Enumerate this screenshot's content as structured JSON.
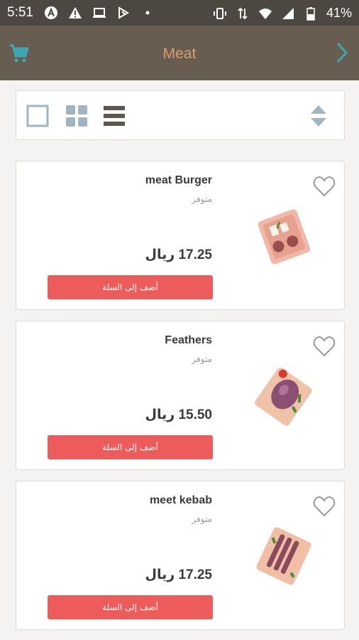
{
  "status_bar": {
    "time": "5:51",
    "battery": "41%",
    "icons_left": [
      "a-circle-icon",
      "warning-icon",
      "laptop-icon",
      "app-icon",
      "dot-icon"
    ],
    "icons_right": [
      "vibrate-icon",
      "data-arrows-icon",
      "wifi-icon",
      "signal-icon",
      "battery-icon"
    ]
  },
  "app_bar": {
    "title": "Meat",
    "left_icon": "cart-icon",
    "right_icon": "chevron-right-icon",
    "colors": {
      "background": "#675d51",
      "title": "#d99d6e",
      "accent": "#3fa7b4"
    }
  },
  "view_toolbar": {
    "options": [
      "single-view-icon",
      "grid-view-icon",
      "list-view-icon"
    ],
    "selected": "list-view-icon",
    "sort_icon": "sort-up-down-icon"
  },
  "products": [
    {
      "name": "meat Burger",
      "availability": "متوفر",
      "price": "17.25 ريال",
      "add_label": "أضف إلى السلة",
      "image": "burger-patties-on-board"
    },
    {
      "name": "Feathers",
      "availability": "متوفر",
      "price": "15.50 ريال",
      "add_label": "أضف إلى السلة",
      "image": "raw-meat-on-board"
    },
    {
      "name": "meet kebab",
      "availability": "متوفر",
      "price": "17.25 ريال",
      "add_label": "أضف إلى السلة",
      "image": "kebab-skewers-on-board"
    }
  ],
  "colors": {
    "add_button": "#ee5b5b",
    "favorite_icon": "#999999"
  }
}
